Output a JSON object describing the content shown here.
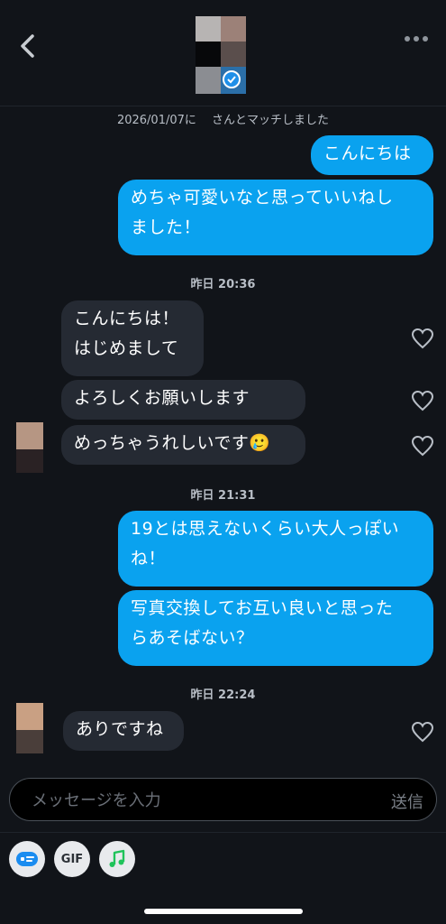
{
  "header": {
    "back_icon": "chevron-left-icon",
    "more_icon": "more-horizontal-icon",
    "verified_icon": "verified-badge-icon"
  },
  "match_notice": "2026/01/07に　 さんとマッチしました",
  "messages": {
    "out1": "こんにちは",
    "out2_line1": "めちゃ可愛いなと思っていいねし",
    "out2_line2": "ました！",
    "ts1": "昨日 20:36",
    "in1_line1": "こんにちは！",
    "in1_line2": "はじめまして",
    "in2": "よろしくお願いします",
    "in3": "めっちゃうれしいです🥲",
    "ts2": "昨日 21:31",
    "out3_line1": "19とは思えないくらい大人っぽい",
    "out3_line2": "ね！",
    "out4_line1": "写真交換してお互い良いと思った",
    "out4_line2": "らあそばない？",
    "ts3": "昨日 22:24",
    "in4": "ありですね"
  },
  "composer": {
    "placeholder": "メッセージを入力",
    "send_label": "送信"
  },
  "toolbar": {
    "sticker_icon": "sticker-icon",
    "gif_label": "GIF",
    "music_icon": "music-note-icon"
  },
  "colors": {
    "background": "#111419",
    "outgoing_bubble": "#0aa2ef",
    "incoming_bubble": "#252a33",
    "music_green": "#1fc35a"
  }
}
